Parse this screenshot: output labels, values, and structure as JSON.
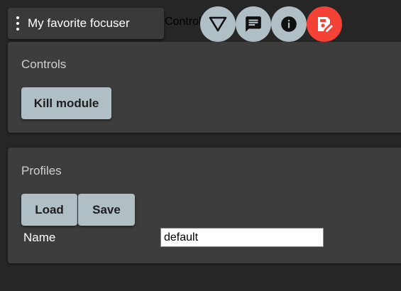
{
  "header": {
    "title": "My favorite focuser",
    "tab_label": "Control",
    "buttons": [
      {
        "icon": "filter-funnel-icon"
      },
      {
        "icon": "chat-message-icon"
      },
      {
        "icon": "info-icon"
      },
      {
        "icon": "save-edit-icon",
        "color": "#f44336"
      }
    ]
  },
  "controls": {
    "title": "Controls",
    "kill_label": "Kill module"
  },
  "profiles": {
    "title": "Profiles",
    "load_label": "Load",
    "save_label": "Save",
    "name_label": "Name",
    "name_value": "default"
  },
  "colors": {
    "background": "#262626",
    "panel": "#3d3d3d",
    "button": "#b0bec5",
    "accent": "#f44336"
  }
}
